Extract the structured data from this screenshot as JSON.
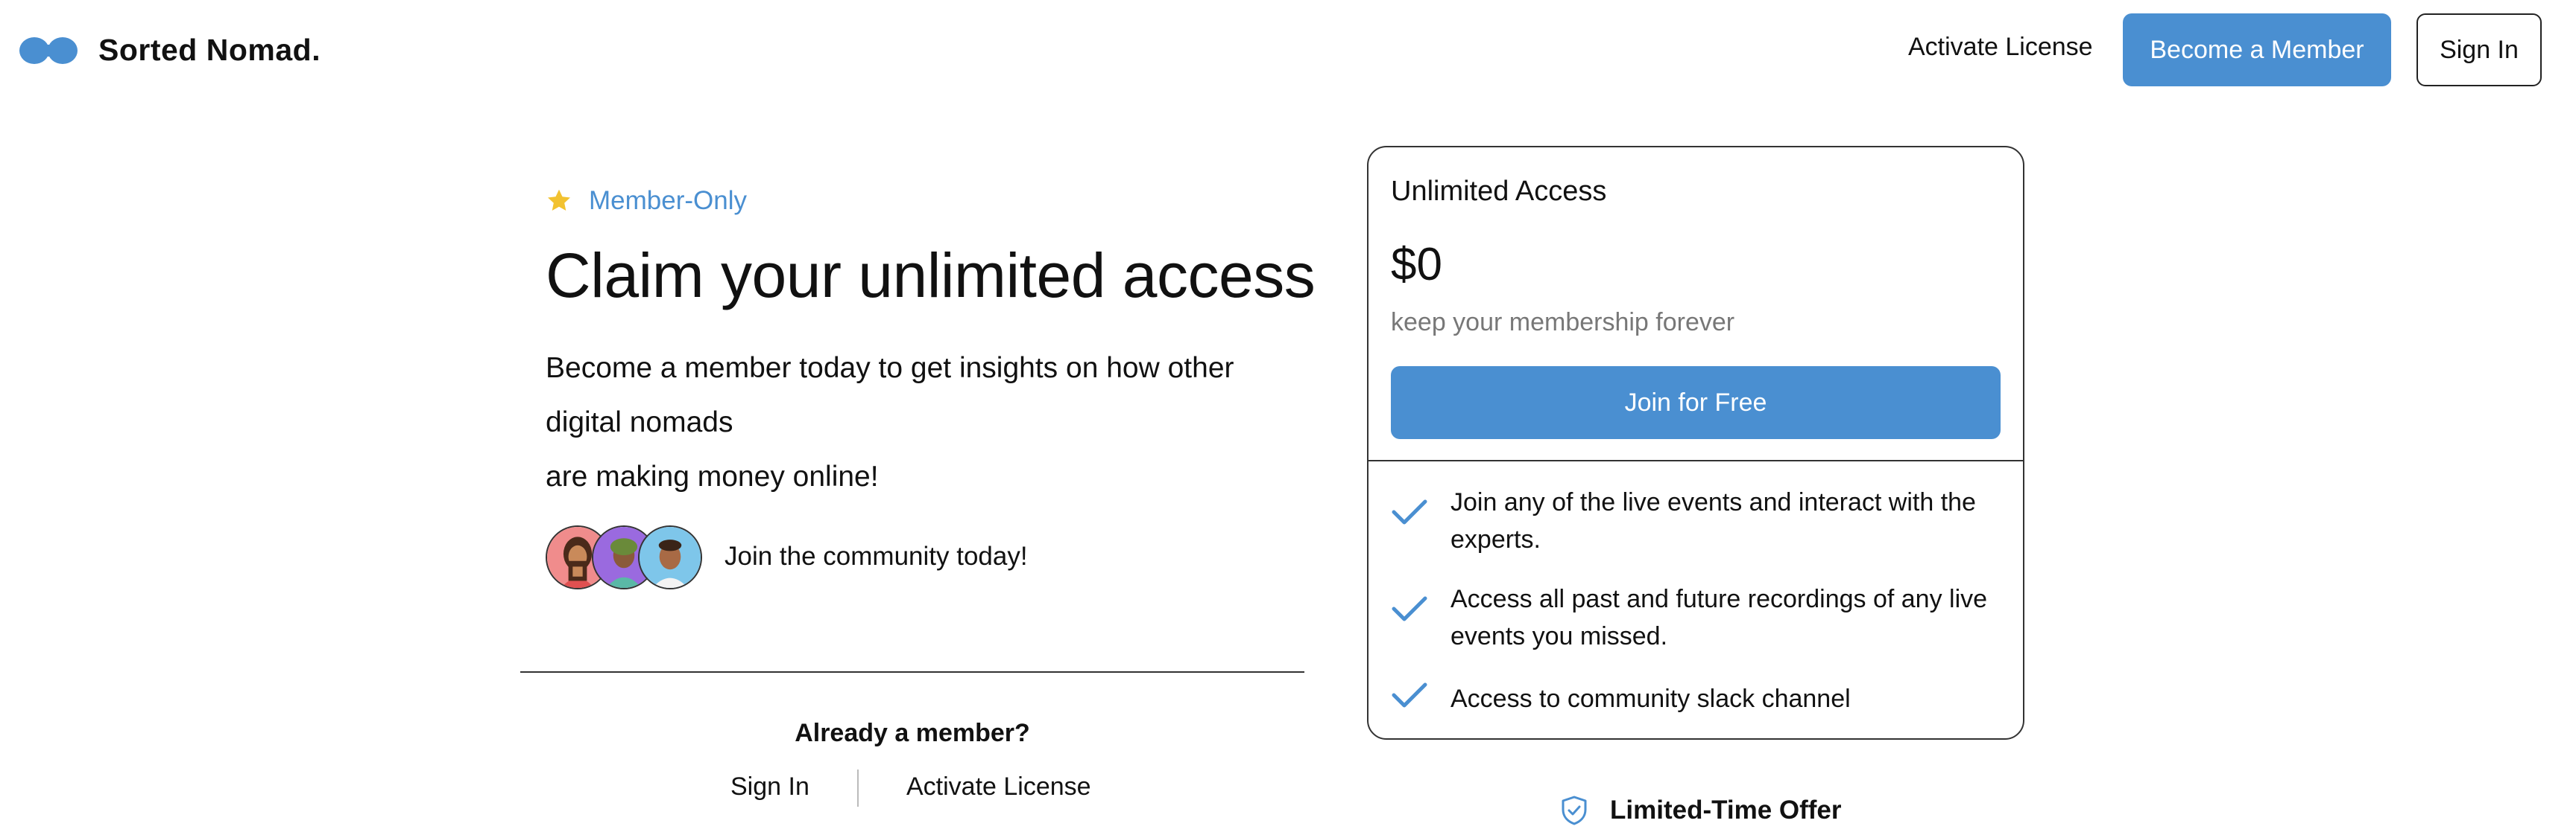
{
  "header": {
    "brand": "Sorted Nomad.",
    "logo_icon": "infinity-blob-logo",
    "activate_label": "Activate License",
    "member_label": "Become a Member",
    "signin_label": "Sign In"
  },
  "hero": {
    "badge_icon": "star-icon",
    "badge": "Member-Only",
    "headline": "Claim your unlimited access",
    "subtext_lines": [
      "Become a member today to get insights on how other",
      "digital nomads",
      "are making money online!"
    ],
    "community": "Join the community today!"
  },
  "member_links": {
    "heading": "Already a member?",
    "signin": "Sign In",
    "activate": "Activate License"
  },
  "card": {
    "title": "Unlimited Access",
    "price": "$0",
    "price_note": "keep your membership forever",
    "button": "Join for Free",
    "features": [
      {
        "icon": "check-icon",
        "text": "Join any of the live events and interact with the experts."
      },
      {
        "icon": "check-icon",
        "text": "Access all past and future recordings of any live events you missed."
      },
      {
        "icon": "check-icon",
        "text": "Access to community slack channel"
      }
    ]
  },
  "offer": {
    "icon": "shield-check-icon",
    "text": "Limited-Time Offer"
  },
  "colors": {
    "accent": "#4a8fd1",
    "star": "#f2c230",
    "muted": "#777777",
    "text": "#111111"
  }
}
